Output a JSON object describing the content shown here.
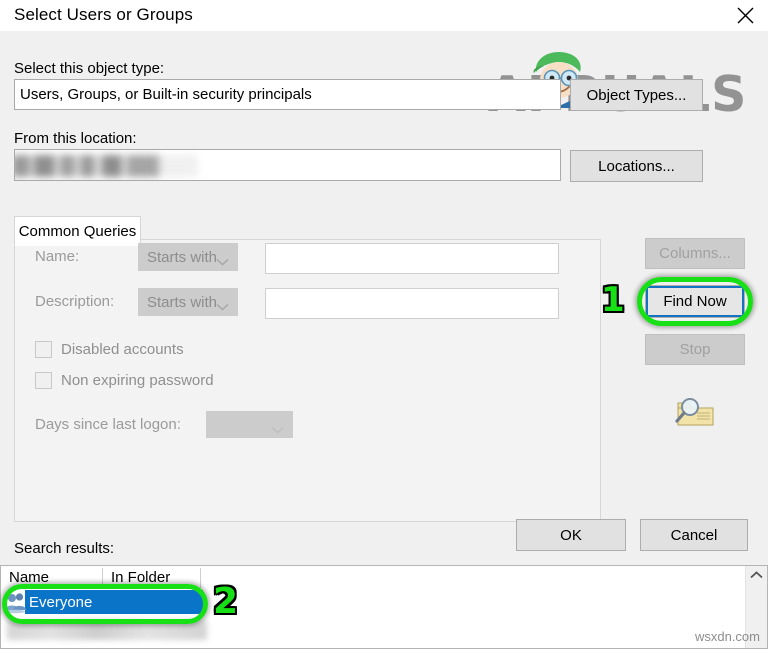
{
  "window": {
    "title": "Select Users or Groups",
    "close_icon": "close-icon"
  },
  "object_type": {
    "label": "Select this object type:",
    "value": "Users, Groups, or Built-in security principals",
    "button": "Object Types..."
  },
  "location": {
    "label": "From this location:",
    "value": "",
    "button": "Locations..."
  },
  "tabs": [
    {
      "label": "Common Queries"
    }
  ],
  "query": {
    "name_label": "Name:",
    "name_operator": "Starts with",
    "name_value": "",
    "description_label": "Description:",
    "description_operator": "Starts with",
    "description_value": "",
    "disabled_accounts_label": "Disabled accounts",
    "disabled_accounts_checked": false,
    "non_expiring_password_label": "Non expiring password",
    "non_expiring_password_checked": false,
    "days_since_logon_label": "Days since last logon:",
    "days_since_logon_value": ""
  },
  "side_buttons": {
    "columns": "Columns...",
    "find_now": "Find Now",
    "stop": "Stop",
    "search_icon": "search-folder-icon"
  },
  "dialog_buttons": {
    "ok": "OK",
    "cancel": "Cancel"
  },
  "results": {
    "label": "Search results:",
    "columns": [
      "Name",
      "In Folder"
    ],
    "rows": [
      {
        "name": "Everyone",
        "in_folder": "",
        "selected": true,
        "icon": "users-group-icon"
      }
    ]
  },
  "annotations": [
    {
      "id": "1",
      "target": "find-now-button"
    },
    {
      "id": "2",
      "target": "result-row-everyone"
    }
  ],
  "watermarks": {
    "brand": "APPUALS",
    "site": "wsxdn.com"
  },
  "colors": {
    "accent_selection": "#0a74c8",
    "annotation_green": "#18e016",
    "focus_blue": "#1573c4",
    "dialog_bg": "#f0f0f0"
  }
}
